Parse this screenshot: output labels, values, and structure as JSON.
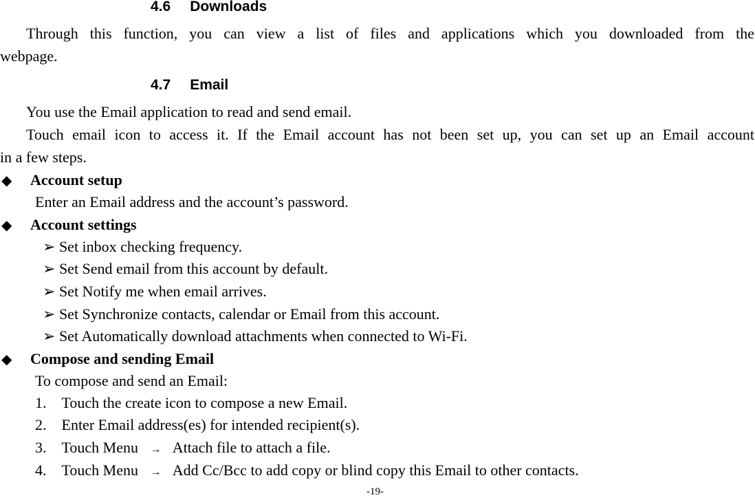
{
  "sections": [
    {
      "number": "4.6",
      "title": "Downloads"
    },
    {
      "number": "4.7",
      "title": "Email"
    }
  ],
  "downloads": {
    "para_line1": "Through this function, you can view a list of files and applications which you downloaded from the",
    "para_line2": "webpage."
  },
  "email": {
    "intro": "You use the Email application to read and send email.",
    "access_line1": "Touch email icon to access it. If the Email account has not been set up, you can set up an Email account",
    "access_line2": "in a few steps.",
    "bullet_glyph": "◆",
    "sub_glyph": "➢",
    "arrow_glyph": "→",
    "account_setup": {
      "title": "Account setup",
      "text": "Enter an Email address and the account’s password."
    },
    "account_settings": {
      "title": "Account settings",
      "items": [
        "Set inbox checking frequency.",
        "Set Send email from this account by default.",
        "Set Notify me when email arrives.",
        "Set Synchronize contacts, calendar or Email from this account.",
        "Set Automatically download attachments when connected to Wi-Fi."
      ]
    },
    "compose": {
      "title": "Compose and sending Email",
      "intro": "To compose and send an Email:",
      "steps": [
        {
          "num": "1.",
          "text": "Touch the create icon to compose a new Email."
        },
        {
          "num": "2.",
          "text": "Enter Email address(es) for intended recipient(s)."
        },
        {
          "num": "3.",
          "pre": "Touch Menu",
          "text": "Attach file to attach a file."
        },
        {
          "num": "4.",
          "pre": "Touch Menu",
          "text": "Add Cc/Bcc to add copy or blind copy this Email to other contacts."
        }
      ]
    }
  },
  "page_number": "-19-"
}
